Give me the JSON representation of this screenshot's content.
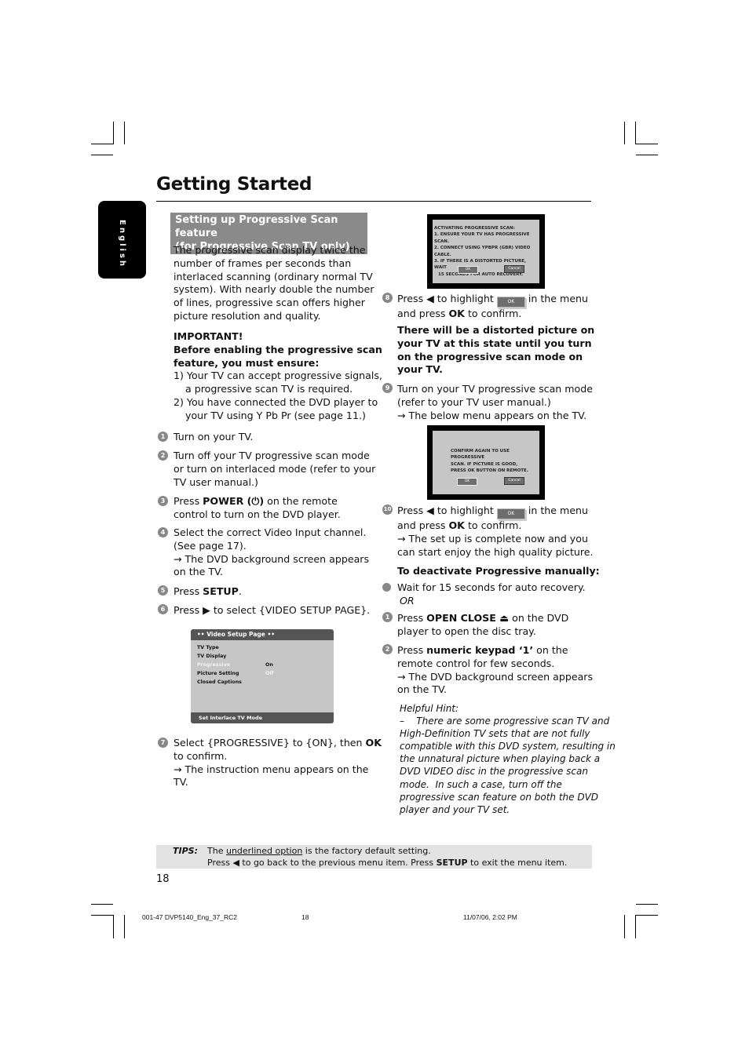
{
  "page": {
    "title": "Getting Started",
    "language_tab": "English",
    "page_number": "18"
  },
  "left": {
    "section_heading_line1": "Setting up Progressive Scan feature",
    "section_heading_line2": "(for Progressive Scan TV only)",
    "intro": [
      "The progressive scan display twice the",
      "number of frames per seconds than",
      "interlaced scanning (ordinary normal TV",
      "system). With nearly double the number",
      "of lines, progressive scan offers higher",
      "picture resolution and quality."
    ],
    "important_title": "IMPORTANT!",
    "important_lead": [
      "Before enabling the progressive scan",
      "feature, you must ensure:"
    ],
    "important_items": [
      [
        "1) Your TV can accept progressive signals,",
        "a progressive scan TV is required."
      ],
      [
        "2) You have connected the DVD player to",
        "your TV using Y Pb Pr (see page 11.)"
      ]
    ],
    "steps": [
      {
        "num": "1",
        "lines": [
          "Turn on your TV."
        ]
      },
      {
        "num": "2",
        "lines": [
          "Turn off your TV progressive scan mode",
          "or turn on interlaced mode (refer to your",
          "TV user manual.)"
        ]
      },
      {
        "num": "3",
        "pre": "Press ",
        "bold": "POWER (⏻)",
        "post": " on the remote",
        "lines": [
          "control to turn on the DVD player."
        ]
      },
      {
        "num": "4",
        "lines": [
          "Select the correct Video Input channel.",
          "(See page 17).",
          "→ The DVD background screen appears",
          "on the TV."
        ]
      },
      {
        "num": "5",
        "pre": "Press ",
        "bold": "SETUP",
        "post": "."
      },
      {
        "num": "6",
        "pre": "Press ▶ to select {VIDEO SETUP PAGE}."
      },
      {
        "num": "7",
        "pre": "Select {PROGRESSIVE} to {ON}, then ",
        "bold": "OK",
        "lines": [
          "to confirm.",
          "→ The instruction menu appears on the",
          "TV."
        ]
      }
    ],
    "video_setup_menu": {
      "header": "••  Video Setup Page  ••",
      "items": [
        "TV Type",
        "TV Display",
        "Progressive",
        "Picture Setting",
        "Closed Captions"
      ],
      "highlighted_item": "Progressive",
      "options": [
        "On",
        "Off"
      ],
      "footer": "Set Interlace TV Mode"
    }
  },
  "right": {
    "tv_screen_1": {
      "lines": [
        "ACTIVATING PROGRESSIVE SCAN:",
        "1. ENSURE YOUR TV HAS PROGRESSIVE SCAN.",
        "2. CONNECT USING YPBPR (GBR) VIDEO CABLE.",
        "3. IF THERE IS A DISTORTED PICTURE, WAIT",
        "   15 SECONDS FOR AUTO RECOVERY."
      ],
      "ok": "OK",
      "cancel": "Cancel"
    },
    "step8": {
      "num": "8",
      "pre": "Press ◀ to highlight",
      "post": "in the menu",
      "line2_pre": "and press ",
      "line2_bold": "OK",
      "line2_post": " to confirm.",
      "button": "OK"
    },
    "warning": [
      "There will be a distorted picture on",
      "your TV at this state until you turn",
      "on the progressive scan mode on",
      "your TV."
    ],
    "step9": {
      "num": "9",
      "lines": [
        "Turn on your TV progressive scan mode",
        "(refer to your TV user manual.)",
        "→ The below menu appears on the TV."
      ]
    },
    "tv_screen_2": {
      "lines": [
        "CONFIRM AGAIN TO USE PROGRESSIVE",
        "SCAN. IF PICTURE IS GOOD,",
        "PRESS OK BUTTON ON REMOTE."
      ],
      "ok": "OK",
      "cancel": "Cancel"
    },
    "step10": {
      "num": "10",
      "pre": "Press ◀ to highlight",
      "post": "in the menu",
      "line2_pre": "and press ",
      "line2_bold": "OK",
      "line2_post": " to confirm.",
      "lines": [
        "→ The set up is complete now and you",
        "can start enjoy the high quality picture."
      ],
      "button": "OK"
    },
    "deactivate_title": "To deactivate Progressive manually:",
    "bullet": "Wait for 15 seconds for auto recovery.",
    "or": "OR",
    "deact1": {
      "num": "1",
      "pre": "Press ",
      "bold": "OPEN CLOSE ⏏",
      "post": " on the DVD",
      "lines": [
        "player to open the disc tray."
      ]
    },
    "deact2": {
      "num": "2",
      "pre": "Press ",
      "bold": "numeric keypad ‘1’",
      "post": " on the",
      "lines": [
        "remote control for few seconds.",
        "→ The DVD background screen appears",
        "on the TV."
      ]
    },
    "hint_title": "Helpful Hint:",
    "hint_lines": [
      "–    There are some progressive scan TV and",
      "High-Definition TV sets that are not fully",
      "compatible with this DVD system, resulting in",
      "the unnatural picture when playing back a",
      "DVD VIDEO disc in the progressive scan",
      "mode.  In such a case, turn off the",
      "progressive scan feature on both the DVD",
      "player and your TV set."
    ]
  },
  "tips": {
    "label": "TIPS:",
    "line1_pre": "The ",
    "line1_underlined": "underlined option",
    "line1_post": " is the factory default setting.",
    "line2_pre": "Press ◀ to go back to the previous menu item. Press ",
    "line2_bold": "SETUP",
    "line2_post": " to exit the menu item."
  },
  "footer": {
    "file": "001-47 DVP5140_Eng_37_RC2",
    "page": "18",
    "timestamp": "11/07/06, 2:02 PM"
  }
}
